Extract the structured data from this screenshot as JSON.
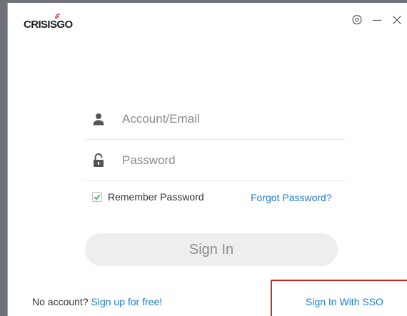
{
  "app": {
    "logo_text_left": "CRISIS",
    "logo_text_right": "GO"
  },
  "window_controls": {
    "settings_icon": "gear-icon",
    "minimize_icon": "minimize-icon",
    "close_icon": "close-icon"
  },
  "login": {
    "account_placeholder": "Account/Email",
    "account_value": "",
    "password_placeholder": "Password",
    "password_value": "",
    "remember_label": "Remember Password",
    "remember_checked": true,
    "forgot_label": "Forgot Password?",
    "signin_label": "Sign In"
  },
  "footer": {
    "no_account_text": "No account?",
    "signup_label": "Sign up for free!",
    "sso_label": "Sign In With SSO"
  },
  "colors": {
    "link": "#1d7cd6",
    "check": "#2eb85c",
    "highlight_box": "#e02020",
    "signin_bg": "#eeeeee"
  }
}
